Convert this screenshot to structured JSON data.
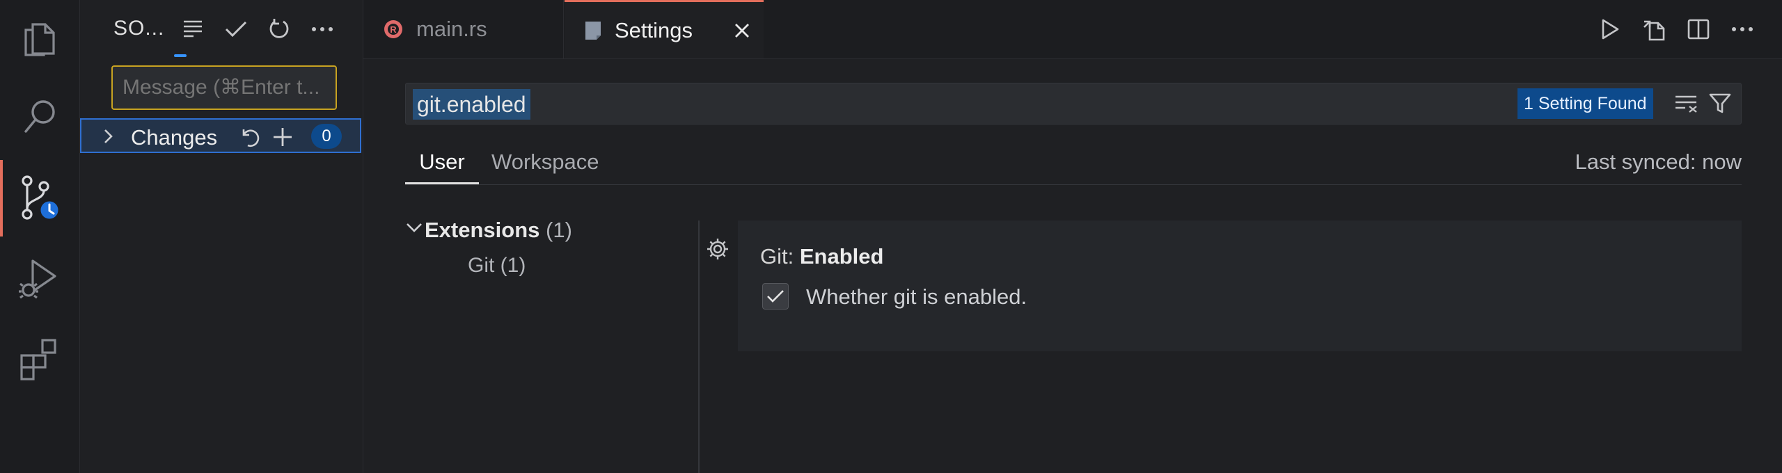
{
  "activity_bar": {
    "items": [
      {
        "name": "explorer",
        "icon": "files-icon"
      },
      {
        "name": "search",
        "icon": "search-icon"
      },
      {
        "name": "source-control",
        "icon": "source-control-icon",
        "active": true
      },
      {
        "name": "run-and-debug",
        "icon": "run-debug-icon"
      },
      {
        "name": "extensions",
        "icon": "extensions-icon"
      }
    ],
    "active_color": "#e36e5c"
  },
  "sidebar": {
    "title": "SO...",
    "commit_placeholder": "Message (⌘Enter t...",
    "changes_label": "Changes",
    "changes_count": "0"
  },
  "tabs": [
    {
      "label": "main.rs",
      "icon": "rust-icon",
      "active": false
    },
    {
      "label": "Settings",
      "icon": "settings-file-icon",
      "active": true
    }
  ],
  "settings": {
    "search_value": "git.enabled",
    "found_badge": "1 Setting Found",
    "scope_tabs": [
      "User",
      "Workspace"
    ],
    "last_synced": "Last synced: now",
    "toc": {
      "section_label": "Extensions",
      "section_count": "(1)",
      "item_label": "Git (1)"
    },
    "setting": {
      "category": "Git: ",
      "name": "Enabled",
      "description": "Whether git is enabled.",
      "checked": true
    }
  },
  "colors": {
    "accent": "#e36e5c",
    "focus_border": "#c8a321",
    "selection_border": "#2f6fd0",
    "badge": "#0d4a8c",
    "search_highlight": "#264f78"
  }
}
